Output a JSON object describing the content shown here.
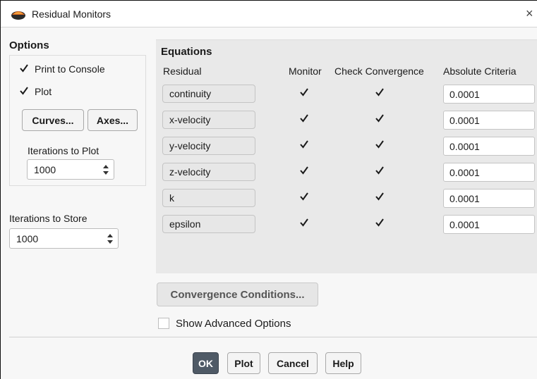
{
  "window": {
    "title": "Residual Monitors",
    "close_symbol": "×",
    "app_icon": "fluent-app-icon"
  },
  "options": {
    "title": "Options",
    "print_to_console": {
      "label": "Print to Console",
      "checked": true
    },
    "plot": {
      "label": "Plot",
      "checked": true
    },
    "curves_button": "Curves...",
    "axes_button": "Axes...",
    "iterations_to_plot": {
      "label": "Iterations to Plot",
      "value": "1000"
    }
  },
  "iterations_to_store": {
    "label": "Iterations to Store",
    "value": "1000"
  },
  "equations": {
    "title": "Equations",
    "headers": {
      "residual": "Residual",
      "monitor": "Monitor",
      "check_convergence": "Check Convergence",
      "absolute_criteria": "Absolute Criteria"
    },
    "rows": [
      {
        "residual": "continuity",
        "monitor": true,
        "check": true,
        "criteria": "0.0001"
      },
      {
        "residual": "x-velocity",
        "monitor": true,
        "check": true,
        "criteria": "0.0001"
      },
      {
        "residual": "y-velocity",
        "monitor": true,
        "check": true,
        "criteria": "0.0001"
      },
      {
        "residual": "z-velocity",
        "monitor": true,
        "check": true,
        "criteria": "0.0001"
      },
      {
        "residual": "k",
        "monitor": true,
        "check": true,
        "criteria": "0.0001"
      },
      {
        "residual": "epsilon",
        "monitor": true,
        "check": true,
        "criteria": "0.0001"
      }
    ]
  },
  "convergence_conditions_button": "Convergence Conditions...",
  "show_advanced": {
    "label": "Show Advanced Options",
    "checked": false
  },
  "footer": {
    "ok": "OK",
    "plot": "Plot",
    "cancel": "Cancel",
    "help": "Help"
  },
  "colors": {
    "ok_button": "#4f5a66",
    "panel": "#e9e9e9"
  }
}
